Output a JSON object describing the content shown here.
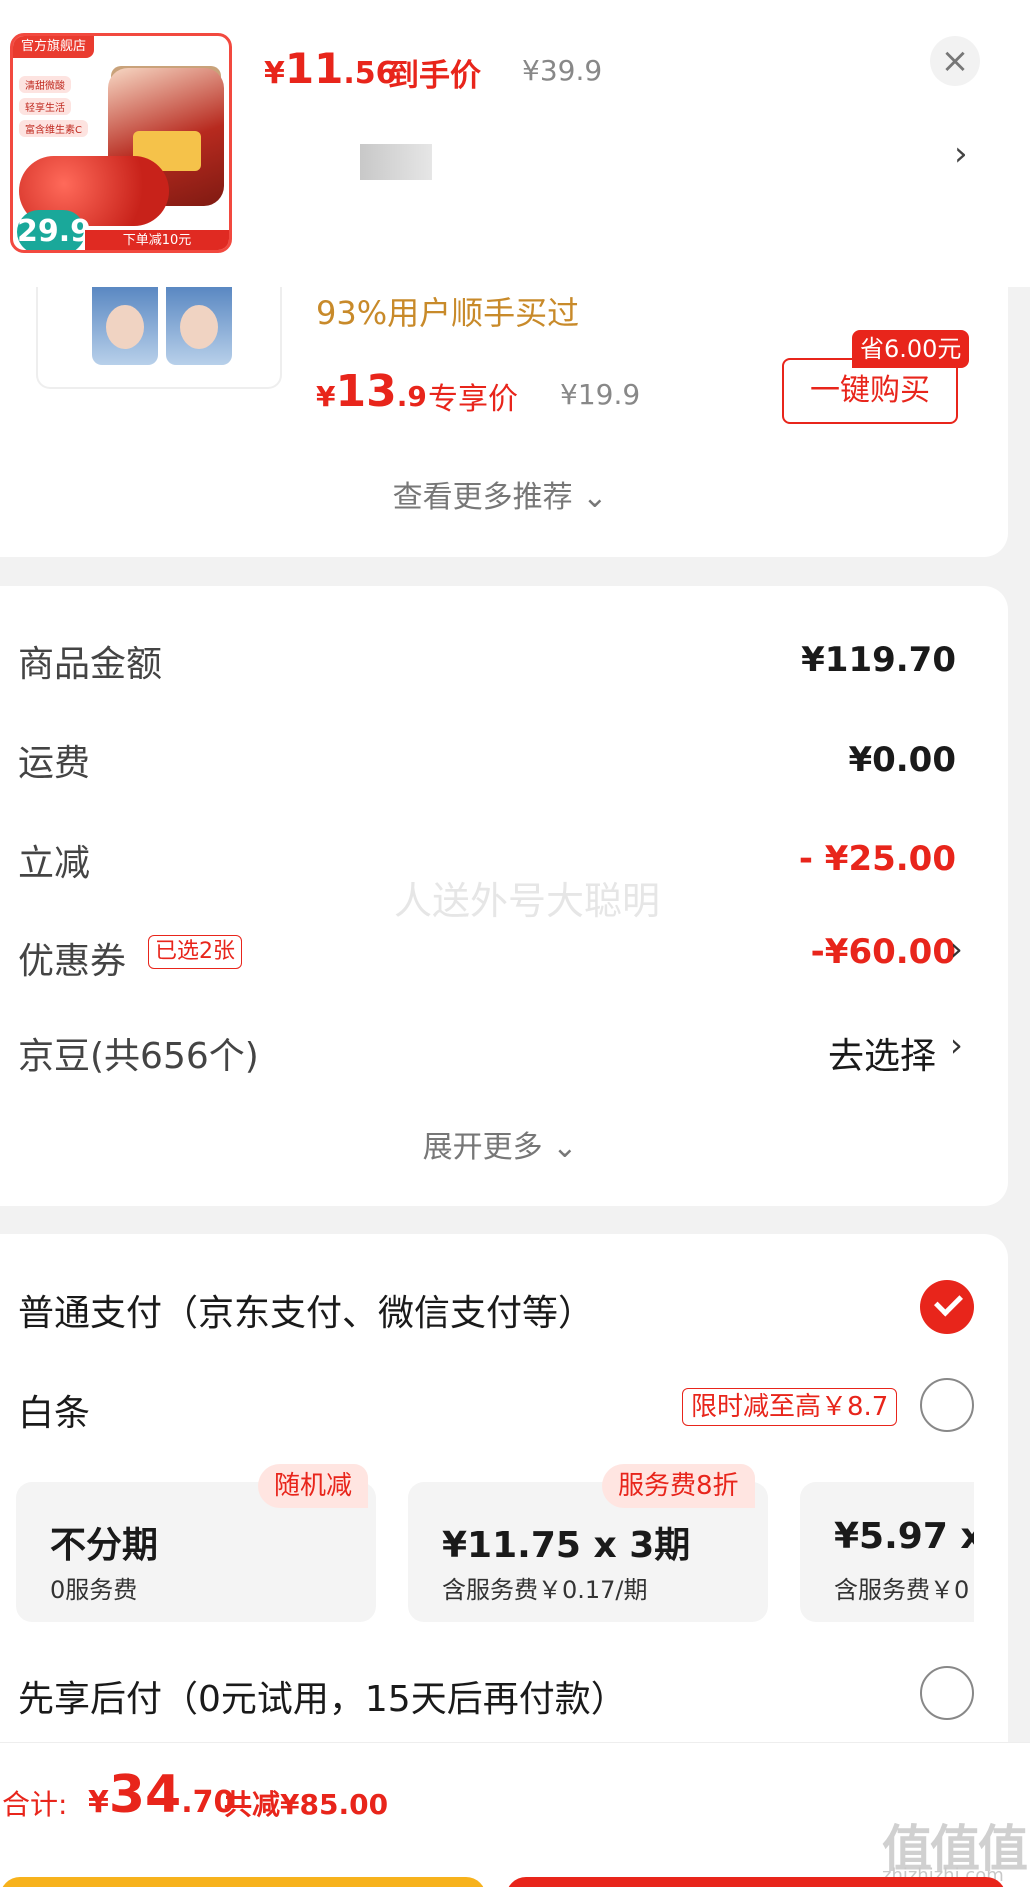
{
  "popup": {
    "price_yen": "¥",
    "price_int": "11",
    "price_dec": ".56",
    "price_label": "到手价",
    "orig_price": "¥39.9",
    "close_icon": "close-icon",
    "arrow_icon": "chevron-right-icon",
    "product_image": {
      "shop_tag": "官方旗舰店",
      "features": [
        "清甜微酸",
        "轻享生活",
        "富含维生素C"
      ],
      "price": "29.9",
      "coupon": "下单减10元"
    }
  },
  "recommend": {
    "tag": "93%用户顺手买过",
    "price_yen": "¥",
    "price_int": "13",
    "price_dec": ".9",
    "price_label": "专享价",
    "orig_price": "¥19.9",
    "save_badge": "省6.00元",
    "buy_button": "一键购买",
    "more": "查看更多推荐 ⌄"
  },
  "amounts": {
    "rows": [
      {
        "label": "商品金额",
        "value": "¥119.70"
      },
      {
        "label": "运费",
        "value": "¥0.00"
      },
      {
        "label": "立减",
        "value": "- ¥25.00"
      },
      {
        "label": "优惠券",
        "value": "-¥60.00"
      },
      {
        "label": "京豆(共656个)",
        "value": "去选择"
      }
    ],
    "coupon_tag": "已选2张",
    "expand": "展开更多 ⌄",
    "watermark": "人送外号大聪明",
    "accent_color": "#e8251b"
  },
  "payment": {
    "normal": "普通支付（京东支付、微信支付等）",
    "baitiao": "白条",
    "promo": "限时减至高￥8.7",
    "installments": [
      {
        "main": "不分期",
        "sub": "0服务费",
        "badge": "随机减"
      },
      {
        "main": "¥11.75 x 3期",
        "sub": "含服务费￥0.17/期",
        "badge": "服务费8折"
      },
      {
        "main": "¥5.97 x",
        "sub": "含服务费￥0",
        "badge": ""
      }
    ],
    "later": "先享后付（0元试用，15天后再付款）"
  },
  "bottom": {
    "total_label": "合计:",
    "total_yen": "¥",
    "total_int": "34",
    "total_dec": ".70",
    "total_save": "共减¥85.00",
    "site_logo": "值值值",
    "site_url": "zhizhizhi.com"
  }
}
